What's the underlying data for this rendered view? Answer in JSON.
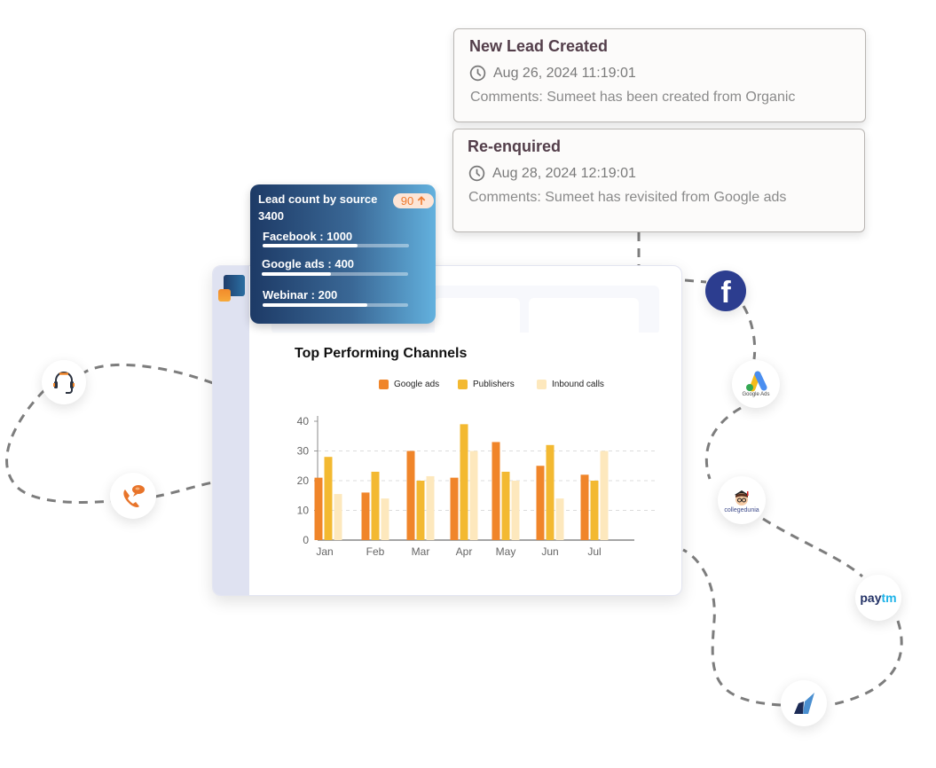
{
  "timeline": [
    {
      "title": "New Lead Created",
      "date": "Aug 26, 2024 11:19:01",
      "comment": "Comments: Sumeet has been created from Organic",
      "icon": "clock-icon"
    },
    {
      "title": "Re-enquired",
      "date": "Aug 28, 2024 12:19:01",
      "comment": "Comments: Sumeet has revisited from Google ads",
      "icon": "clock-icon"
    }
  ],
  "lead_card": {
    "title": "Lead count by source",
    "total": "3400",
    "badge": "90",
    "badge_icon": "arrow-up-icon",
    "sources": [
      {
        "label": "Facebook : 1000",
        "progress": 0.65
      },
      {
        "label": "Google ads : 400",
        "progress": 0.47
      },
      {
        "label": "Webinar : 200",
        "progress": 0.72
      }
    ]
  },
  "logos": [
    "headset-icon",
    "phone-chat-icon",
    "facebook-logo",
    "google-ads-logo",
    "collegedunia-logo",
    "paytm-logo",
    "flight-logo"
  ],
  "logo_text": {
    "google_ads": "Google Ads",
    "collegedunia": "collegedunia",
    "paytm_pay": "pay",
    "paytm_tm": "tm",
    "facebook": "f"
  },
  "colors": {
    "google_ads": "#f0852a",
    "publishers": "#f3b931",
    "inbound_calls": "#fde8bd"
  },
  "chart_data": {
    "type": "bar",
    "title": "Top Performing Channels",
    "categories": [
      "Jan",
      "Feb",
      "Mar",
      "Apr",
      "May",
      "Jun",
      "Jul"
    ],
    "series": [
      {
        "name": "Google ads",
        "values": [
          21,
          16,
          30,
          21,
          33,
          25,
          22
        ]
      },
      {
        "name": "Publishers",
        "values": [
          28,
          23,
          20,
          39,
          23,
          32,
          20
        ]
      },
      {
        "name": "Inbound calls",
        "values": [
          15.5,
          14,
          21.5,
          30,
          20,
          14,
          30
        ]
      }
    ],
    "xlabel": "",
    "ylabel": "",
    "ylim": [
      0,
      40
    ],
    "yticks": [
      0,
      10,
      20,
      30,
      40
    ],
    "grid": true,
    "legend": "top"
  }
}
